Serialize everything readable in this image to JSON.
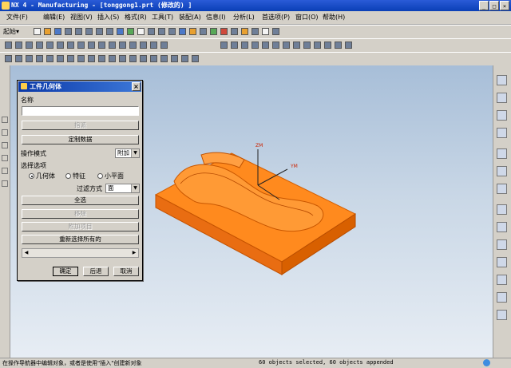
{
  "window": {
    "title": "NX 4 - Manufacturing - [tonggong1.prt  (修改的) ]",
    "controls": [
      "_",
      "□",
      "×"
    ]
  },
  "menubar": {
    "items": [
      "文件(F)",
      "编辑(E)",
      "视图(V)",
      "插入(S)",
      "格式(R)",
      "工具(T)",
      "装配(A)",
      "信息(I)",
      "分析(L)",
      "首选项(P)",
      "窗口(O)",
      "帮助(H)"
    ]
  },
  "toolbar": {
    "start_label": "起始"
  },
  "dialog": {
    "title": "工件几何体",
    "name_label": "名称",
    "name_value": "",
    "btn_assign": "指派",
    "btn_custom_data": "定制数据",
    "operation_mode_label": "操作模式",
    "operation_mode_value": "附加",
    "selection_options_label": "选择选项",
    "radio_geometry": "几何体",
    "radio_feature": "特征",
    "radio_facet": "小平面",
    "filter_label": "过滤方式",
    "filter_value": "面",
    "btn_select_all": "全选",
    "btn_remove": "移除",
    "btn_append": "附加项目",
    "btn_reselect": "重新选择所有的",
    "btn_ok": "确定",
    "btn_back": "后退",
    "btn_cancel": "取消"
  },
  "viewport": {
    "axis_z": "ZM",
    "axis_y": "YM",
    "part_color": "#ff8a1e",
    "background_top": "#a7bed8",
    "background_bottom": "#e7edf4"
  },
  "status": {
    "prompt": "在操作导航器中编辑对象，或者是使用\"插入\"创建新对象",
    "message": "60 objects selected, 60 objects appended"
  }
}
